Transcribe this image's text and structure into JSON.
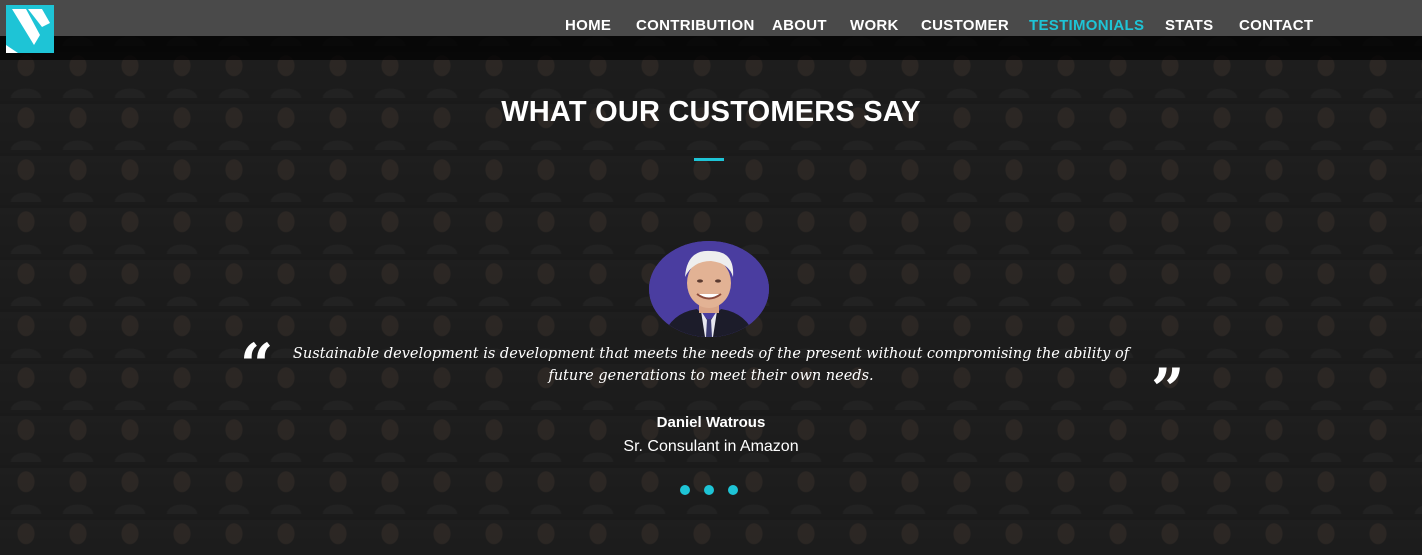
{
  "nav": {
    "items": [
      {
        "label": "HOME",
        "active": false
      },
      {
        "label": "CONTRIBUTION",
        "active": false
      },
      {
        "label": "ABOUT",
        "active": false
      },
      {
        "label": "WORK",
        "active": false
      },
      {
        "label": "CUSTOMER",
        "active": false
      },
      {
        "label": "TESTIMONIALS",
        "active": true
      },
      {
        "label": "STATS",
        "active": false
      },
      {
        "label": "CONTACT",
        "active": false
      }
    ]
  },
  "logo": {
    "icon": "logo-icon"
  },
  "section": {
    "title": "WHAT OUR CUSTOMERS SAY"
  },
  "testimonial": {
    "quote_line1": "Sustainable development is development that meets the needs of the present without compromising the ability of",
    "quote_line2": "future generations to meet their own needs.",
    "open_quote": "“",
    "close_quote": "”",
    "author": "Daniel Watrous",
    "role": "Sr. Consulant in Amazon"
  },
  "carousel": {
    "dot_count": 3,
    "active_index": 0
  },
  "colors": {
    "accent": "#1ec4d6",
    "header_bg": "#4a4a4a",
    "text": "#ffffff"
  }
}
